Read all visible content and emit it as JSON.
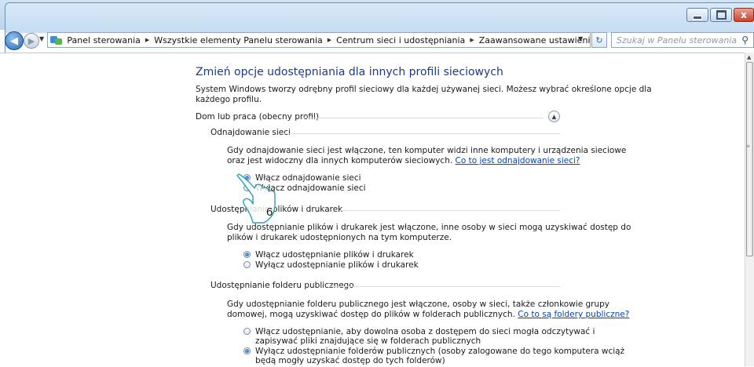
{
  "window": {
    "close_glyph": "x"
  },
  "address": {
    "crumbs": [
      "Panel sterowania",
      "Wszystkie elementy Panelu sterowania",
      "Centrum sieci i udostępniania",
      "Zaawansowane ustawienia udostępniania"
    ],
    "search_placeholder": "Szukaj w Panelu sterowania"
  },
  "page": {
    "heading": "Zmień opcje udostępniania dla innych profili sieciowych",
    "intro_line1": "System Windows tworzy odrębny profil sieciowy dla każdej używanej sieci. Możesz wybrać określone opcje dla",
    "intro_line2": "każdego profilu.",
    "profile_label": "Dom lub praca (obecny profil)"
  },
  "sections": {
    "discovery": {
      "title": "Odnajdowanie sieci",
      "desc1": "Gdy odnajdowanie sieci jest włączone, ten komputer widzi inne komputery i urządzenia sieciowe",
      "desc2": "oraz jest widoczny dla innych komputerów sieciowych.",
      "link": "Co to jest odnajdowanie sieci?",
      "opt_on": "Włącz odnajdowanie sieci",
      "opt_off": "Wyłącz odnajdowanie sieci"
    },
    "printers": {
      "title": "Udostępnianie plików i drukarek",
      "desc1": "Gdy udostępnianie plików i drukarek jest włączone, inne osoby w sieci mogą uzyskiwać dostęp do",
      "desc2": "plików i drukarek udostępnionych na tym komputerze.",
      "opt_on": "Włącz udostępnianie plików i drukarek",
      "opt_off": "Wyłącz udostępnianie plików i drukarek"
    },
    "public": {
      "title": "Udostępnianie folderu publicznego",
      "desc1": "Gdy udostępnianie folderu publicznego jest włączone, osoby w sieci, także członkowie grupy",
      "desc2": "domowej, mogą uzyskiwać dostęp do plików w folderach publicznych.",
      "link": "Co to są foldery publiczne?",
      "opt_on_line1": "Włącz udostępnianie, aby dowolna osoba z dostępem do sieci mogła odczytywać i",
      "opt_on_line2": "zapisywać pliki znajdujące się w folderach publicznych",
      "opt_off_line1": "Wyłącz udostępnianie folderów publicznych (osoby zalogowane do tego komputera wciąż",
      "opt_off_line2": "będą mogły uzyskać dostęp do tych folderów)"
    }
  },
  "callout": {
    "number": "6"
  }
}
